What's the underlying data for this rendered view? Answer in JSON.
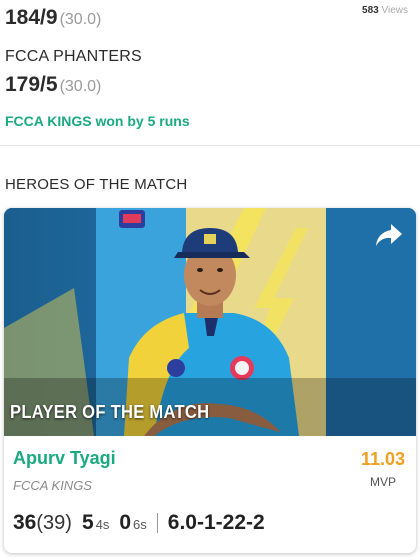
{
  "innings1": {
    "runs_wickets": "184/9",
    "overs": "(30.0)"
  },
  "views": {
    "count": "583",
    "label": "Views"
  },
  "innings2": {
    "team": "FCCA PHANTERS",
    "runs_wickets": "179/5",
    "overs": "(30.0)"
  },
  "result": "FCCA KINGS won by 5 runs",
  "heroes": {
    "title": "HEROES OF THE MATCH",
    "banner": "PLAYER OF THE MATCH",
    "player": {
      "name": "Apurv Tyagi",
      "team": "FCCA KINGS",
      "mvp_value": "11.03",
      "mvp_label": "MVP",
      "runs": "36",
      "balls": "(39)",
      "fours": "5",
      "fours_label": "4s",
      "sixes": "0",
      "sixes_label": "6s",
      "bowling": "6.0-1-22-2"
    }
  },
  "colors": {
    "accent_green": "#1aa980",
    "mvp_orange": "#f0a020"
  },
  "icons": {
    "share": "share-arrow-icon"
  }
}
